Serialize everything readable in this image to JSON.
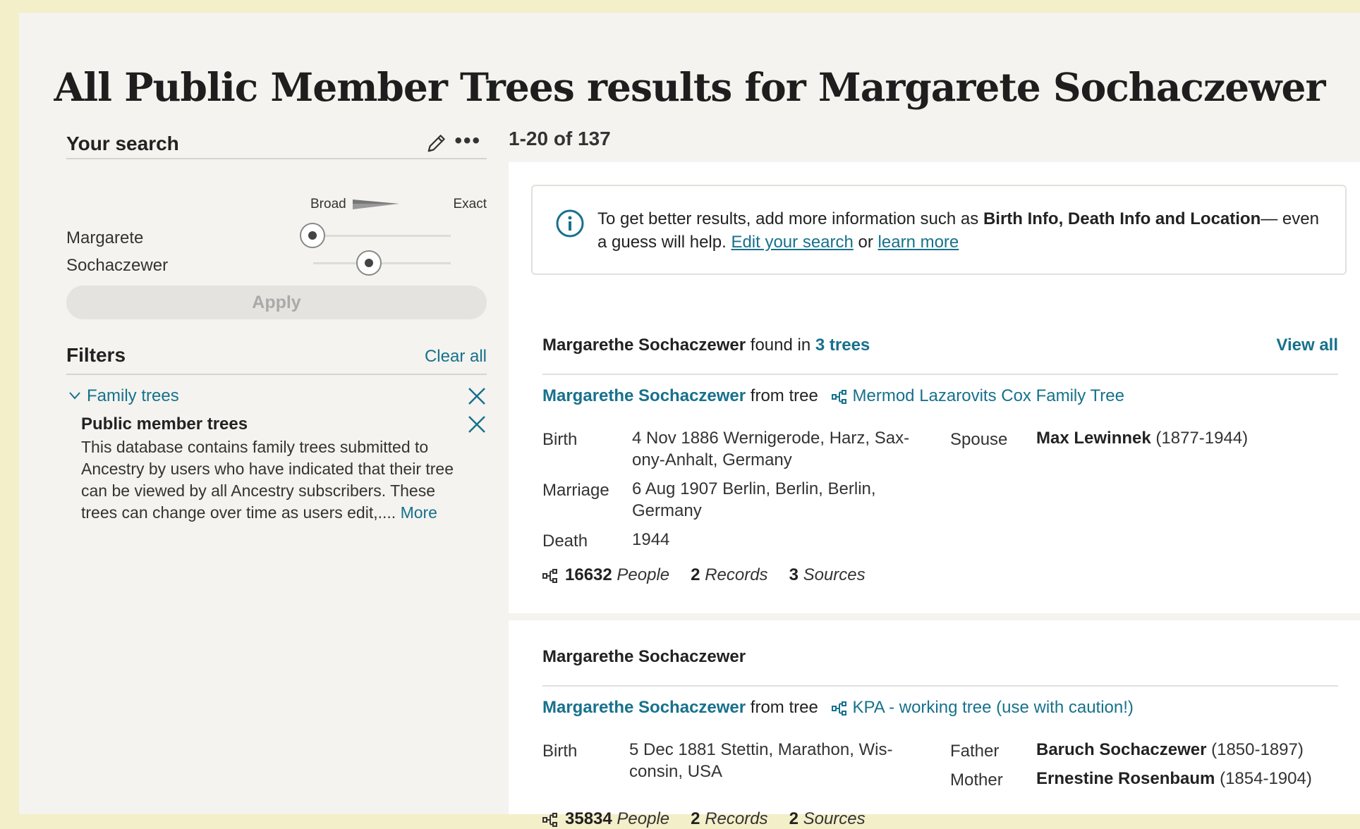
{
  "page_title": "All Public Member Trees results for Margarete Sochaczewer",
  "search": {
    "title": "Your search",
    "scale_broad": "Broad",
    "scale_exact": "Exact",
    "first_name": "Margarete",
    "last_name": "Sochaczewer",
    "first_name_exactness": 0.0,
    "last_name_exactness": 0.33,
    "apply_label": "Apply"
  },
  "filters": {
    "title": "Filters",
    "clear_all": "Clear all",
    "category": "Family trees",
    "collection_title": "Public member trees",
    "collection_desc": "This database contains family trees submitted to Ancestry by users who have indicated that their tree can be viewed by all Ancestry subscribers. These trees can change over time as users edit,....",
    "more": "More"
  },
  "results": {
    "count": "1-20 of 137",
    "info": {
      "text_1": "To get better results, add more information such as ",
      "bold": "Birth Info, Death Info and Location",
      "text_2": "— even a guess will help. ",
      "edit_link": "Edit your search",
      "or": " or ",
      "learn_link": "learn more"
    },
    "cards": [
      {
        "name": "Margarethe Sochaczewer",
        "found_in": " found in ",
        "tree_count": "3 trees",
        "view_all": "View all",
        "person": "Margarethe Sochaczewer",
        "from_tree": " from tree",
        "tree_name": "Mermod Lazarovits Cox Family Tree",
        "facts": [
          {
            "label": "Birth",
            "value": "4 Nov 1886 Wernigerode, Harz, Sax-ony-Anhalt, Germany"
          },
          {
            "label": "Marriage",
            "value": "6 Aug 1907 Berlin, Berlin, Berlin, Germany"
          },
          {
            "label": "Death",
            "value": "1944"
          }
        ],
        "relations": [
          {
            "label": "Spouse",
            "name": "Max Lewinnek",
            "years": " (1877-1944)"
          }
        ],
        "people": "16632",
        "people_label": "People",
        "records": "2",
        "records_label": "Records",
        "sources": "3",
        "sources_label": "Sources"
      },
      {
        "name": "Margarethe Sochaczewer",
        "person": "Margarethe Sochaczewer",
        "from_tree": " from tree",
        "tree_name": "KPA - working tree (use with caution!)",
        "facts": [
          {
            "label": "Birth",
            "value": "5 Dec 1881 Stettin, Marathon, Wis-consin, USA"
          }
        ],
        "relations": [
          {
            "label": "Father",
            "name": "Baruch Sochaczewer",
            "years": " (1850-1897)"
          },
          {
            "label": "Mother",
            "name": "Ernestine Rosenbaum",
            "years": " (1854-1904)"
          }
        ],
        "people": "35834",
        "people_label": "People",
        "records": "2",
        "records_label": "Records",
        "sources": "2",
        "sources_label": "Sources"
      }
    ]
  },
  "colors": {
    "link": "#17718c",
    "page_bg": "#f4f3ef",
    "outer_bg": "#f3efc9"
  }
}
